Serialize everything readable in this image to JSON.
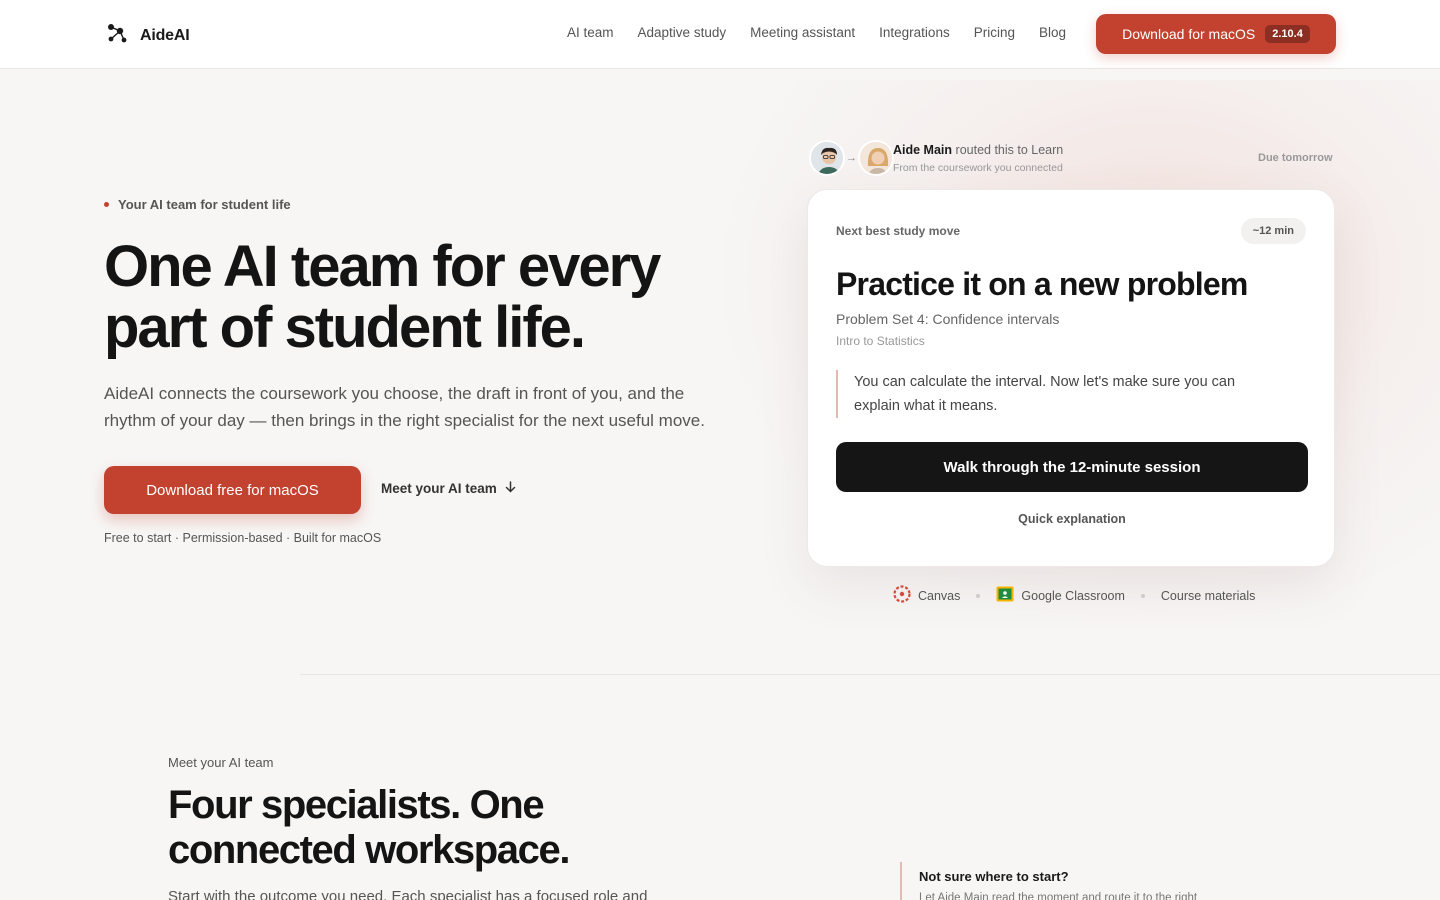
{
  "nav": {
    "brand": "AideAI",
    "links": [
      "AI team",
      "Adaptive study",
      "Meeting assistant",
      "Integrations",
      "Pricing",
      "Blog"
    ],
    "cta_label": "Download for macOS",
    "version": "2.10.4"
  },
  "hero": {
    "eyebrow": "Your AI team for student life",
    "title": "One AI team for every part of student life.",
    "subtitle": "AideAI connects the coursework you choose, the draft in front of you, and the rhythm of your day — then brings in the right specialist for the next useful move.",
    "cta_label": "Download free for macOS",
    "secondary_link": "Meet your AI team",
    "footnote": "Free to start · Permission-based · Built for macOS"
  },
  "routing": {
    "agent_name": "Aide Main",
    "action": "routed this to Learn",
    "source": "From the coursework you connected",
    "due": "Due tomorrow"
  },
  "card": {
    "eyebrow": "Next best study move",
    "duration": "~12 min",
    "title": "Practice it on a new problem",
    "assignment": "Problem Set 4: Confidence intervals",
    "course": "Intro to Statistics",
    "quote": "You can calculate the interval. Now let's make sure you can explain what it means.",
    "primary_button": "Walk through the 12-minute session",
    "secondary_link": "Quick explanation"
  },
  "integrations": [
    "Canvas",
    "Google Classroom",
    "Course materials"
  ],
  "section2": {
    "eyebrow": "Meet your AI team",
    "title": "Four specialists. One connected workspace.",
    "subtitle": "Start with the outcome you need. Each specialist has a focused role and",
    "aside_title": "Not sure where to start?",
    "aside_sub": "Let Aide Main read the moment and route it to the right"
  },
  "colors": {
    "accent": "#c2412f",
    "background": "#f7f6f5",
    "dark_button": "#151515"
  }
}
